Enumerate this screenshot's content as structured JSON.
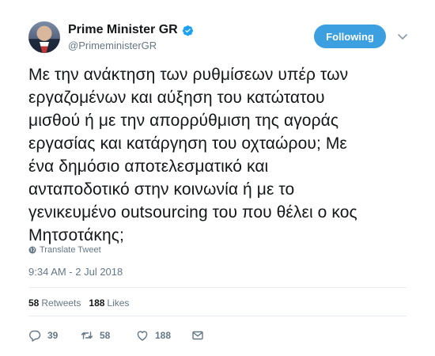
{
  "user": {
    "display_name": "Prime Minister GR",
    "handle": "@PrimeministerGR",
    "avatar_icon": "avatar-photo",
    "verified_icon": "verified-badge-icon"
  },
  "follow_button": {
    "label": "Following"
  },
  "tweet": {
    "text": "Με την ανάκτηση των ρυθμίσεων υπέρ των\nεργαζομένων και αύξηση του κατώτατου\nμισθού ή με την απορρύθμιση της αγοράς\nεργασίας και κατάργηση του οχταώρου; Με\nένα δημόσιο αποτελεσματικό και\nανταποδοτικό στην κοινωνία ή με το\nγενικευμένο outsourcing του που θέλει ο κος\nΜητσοτάκης;",
    "translate_label": "Translate Tweet",
    "timestamp": "9:34 AM - 2 Jul 2018"
  },
  "stats": {
    "retweets_count": "58",
    "retweets_label": "Retweets",
    "likes_count": "188",
    "likes_label": "Likes"
  },
  "actions": {
    "reply_count": "39",
    "retweet_count": "58",
    "like_count": "188"
  },
  "colors": {
    "accent": "#3b9fe0",
    "secondary_text": "#657786",
    "divider": "#e6ecf0"
  }
}
